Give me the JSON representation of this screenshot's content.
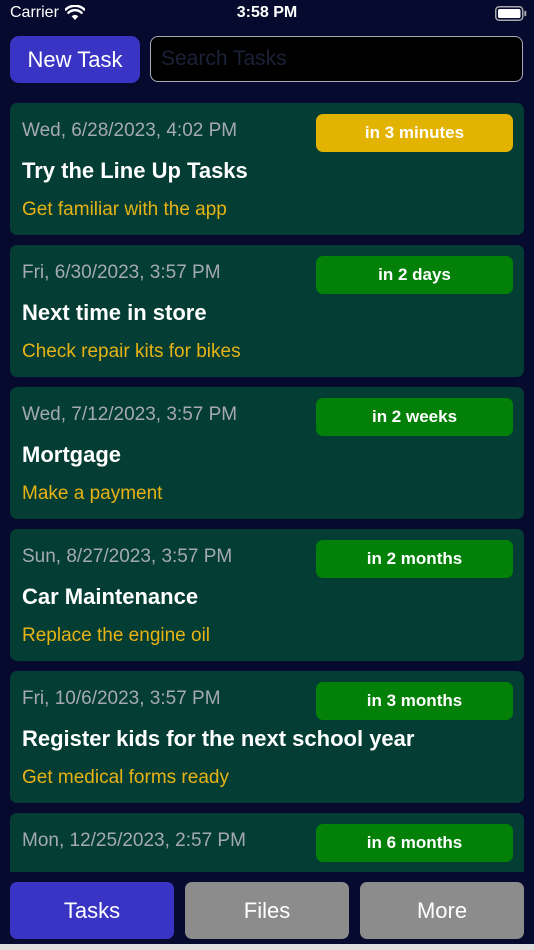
{
  "status_bar": {
    "carrier": "Carrier",
    "time": "3:58 PM"
  },
  "toolbar": {
    "new_task_label": "New Task",
    "search_placeholder": "Search Tasks"
  },
  "colors": {
    "background": "#050a2e",
    "card": "#033d33",
    "accent_blue": "#3a34c4",
    "badge_soon": "#e3b301",
    "badge_later": "#028007",
    "subtitle": "#e7b314",
    "tab_inactive": "#8c8c8c"
  },
  "tasks": [
    {
      "date": "Wed, 6/28/2023, 4:02 PM",
      "badge": "in 3 minutes",
      "badge_color": "#e3b301",
      "title": "Try the Line Up Tasks",
      "subtitle": "Get familiar with the app"
    },
    {
      "date": "Fri, 6/30/2023, 3:57 PM",
      "badge": "in 2 days",
      "badge_color": "#028007",
      "title": "Next time in store",
      "subtitle": "Check repair kits for bikes"
    },
    {
      "date": "Wed, 7/12/2023, 3:57 PM",
      "badge": "in 2 weeks",
      "badge_color": "#028007",
      "title": "Mortgage",
      "subtitle": "Make a payment"
    },
    {
      "date": "Sun, 8/27/2023, 3:57 PM",
      "badge": "in 2 months",
      "badge_color": "#028007",
      "title": "Car Maintenance",
      "subtitle": "Replace the engine oil"
    },
    {
      "date": "Fri, 10/6/2023, 3:57 PM",
      "badge": "in 3 months",
      "badge_color": "#028007",
      "title": "Register kids for the next school year",
      "subtitle": "Get medical forms ready"
    },
    {
      "date": "Mon, 12/25/2023, 2:57 PM",
      "badge": "in 6 months",
      "badge_color": "#028007",
      "title": "",
      "subtitle": ""
    }
  ],
  "tab_bar": {
    "tabs": [
      {
        "label": "Tasks",
        "color": "#3a34c4"
      },
      {
        "label": "Files",
        "color": "#8c8c8c"
      },
      {
        "label": "More",
        "color": "#8c8c8c"
      }
    ]
  }
}
